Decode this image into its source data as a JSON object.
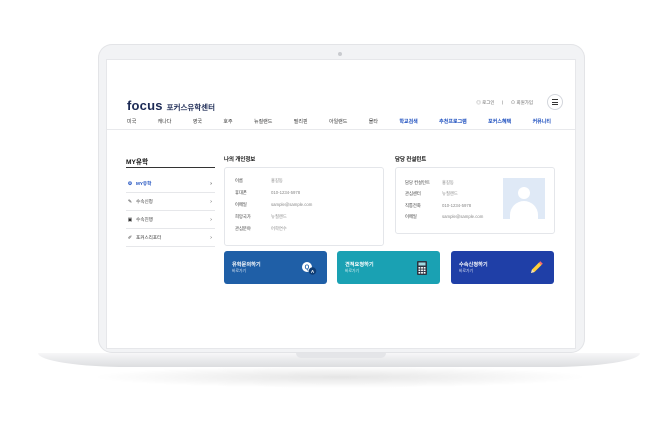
{
  "header": {
    "logo": "focus",
    "subtitle": "포커스유학센터",
    "utils": [
      "◎ 로그인",
      "ㅣ",
      "⊙ 회원가입"
    ]
  },
  "nav": [
    {
      "label": "미국",
      "hl": false
    },
    {
      "label": "캐나다",
      "hl": false
    },
    {
      "label": "영국",
      "hl": false
    },
    {
      "label": "호주",
      "hl": false
    },
    {
      "label": "뉴질랜드",
      "hl": false
    },
    {
      "label": "필리핀",
      "hl": false
    },
    {
      "label": "아일랜드",
      "hl": false
    },
    {
      "label": "몰타",
      "hl": false
    },
    {
      "label": "학교검색",
      "hl": true
    },
    {
      "label": "추천프로그램",
      "hl": true
    },
    {
      "label": "포커스혜택",
      "hl": true
    },
    {
      "label": "커뮤니티",
      "hl": true
    }
  ],
  "sidebar": {
    "title": "MY유학",
    "items": [
      {
        "label": "MY유학",
        "icon": "⚙",
        "active": true
      },
      {
        "label": "수속신청",
        "icon": "✎",
        "active": false
      },
      {
        "label": "수속진행",
        "icon": "▣",
        "active": false
      },
      {
        "label": "포커스리포터",
        "icon": "✐",
        "active": false
      }
    ]
  },
  "personal": {
    "title": "나의 개인정보",
    "rows": [
      {
        "k": "이름",
        "v": "홍길동"
      },
      {
        "k": "휴대폰",
        "v": "010-1234-5978"
      },
      {
        "k": "이메일",
        "v": "sample@sample.com"
      },
      {
        "k": "희망국가",
        "v": "뉴질랜드"
      },
      {
        "k": "관심분야",
        "v": "어학연수"
      }
    ]
  },
  "consultant": {
    "title": "담당 컨설턴트",
    "rows": [
      {
        "k": "담당 컨설턴트",
        "v": "홍길동"
      },
      {
        "k": "관심센터",
        "v": "뉴질랜드"
      },
      {
        "k": "직통전화",
        "v": "010-1234-5978"
      },
      {
        "k": "이메일",
        "v": "sample@sample.com"
      }
    ]
  },
  "tiles": [
    {
      "title": "유학문의하기",
      "sub": "바로가기",
      "color": "#1f5fa7",
      "icon": "qa-icon"
    },
    {
      "title": "견적요청하기",
      "sub": "바로가기",
      "color": "#1aa1b3",
      "icon": "calculator-icon"
    },
    {
      "title": "수속신청하기",
      "sub": "바로가기",
      "color": "#1f3fa7",
      "icon": "pencil-icon"
    }
  ]
}
